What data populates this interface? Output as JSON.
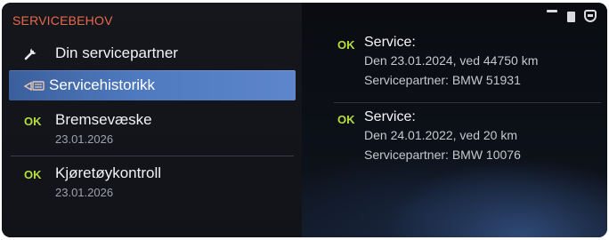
{
  "panel": {
    "title": "SERVICEBEHOV"
  },
  "menu": {
    "partner": {
      "label": "Din servicepartner",
      "icon": "wrench-icon"
    },
    "history": {
      "label": "Servicehistorikk",
      "icon": "service-book-icon"
    },
    "items": [
      {
        "status": "OK",
        "label": "Bremsevæske",
        "date": "23.01.2026"
      },
      {
        "status": "OK",
        "label": "Kjøretøykontroll",
        "date": "23.01.2026"
      }
    ]
  },
  "history_entries": [
    {
      "status": "OK",
      "title": "Service:",
      "line1": "Den 23.01.2024, ved 44750 km",
      "line2": "Servicepartner: BMW 51931"
    },
    {
      "status": "OK",
      "title": "Service:",
      "line1": "Den 24.01.2022, ved 20 km",
      "line2": "Servicepartner: BMW 10076"
    }
  ],
  "colors": {
    "title_accent": "#e86a4a",
    "ok_green": "#b6de3c",
    "selection_blue": "#4f7ac0"
  }
}
